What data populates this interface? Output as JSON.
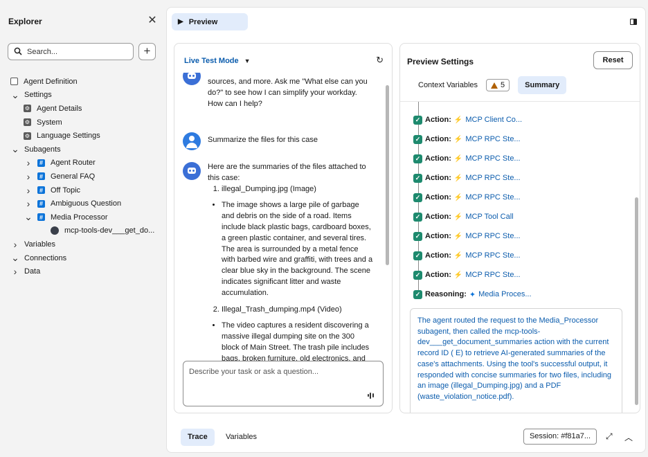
{
  "explorer": {
    "title": "Explorer",
    "search_placeholder": "Search...",
    "tree": [
      {
        "label": "Agent Definition",
        "icon": "document-icon",
        "indent": 0,
        "chevron": ""
      },
      {
        "label": "Settings",
        "icon": "",
        "indent": 0,
        "chevron": "down"
      },
      {
        "label": "Agent Details",
        "icon": "gear-icon",
        "indent": 1,
        "chevron": ""
      },
      {
        "label": "System",
        "icon": "gear-icon",
        "indent": 1,
        "chevron": ""
      },
      {
        "label": "Language Settings",
        "icon": "gear-icon",
        "indent": 1,
        "chevron": ""
      },
      {
        "label": "Subagents",
        "icon": "",
        "indent": 0,
        "chevron": "down"
      },
      {
        "label": "Agent Router",
        "icon": "hash-icon",
        "indent": 1,
        "chevron": "right"
      },
      {
        "label": "General FAQ",
        "icon": "hash-icon",
        "indent": 1,
        "chevron": "right"
      },
      {
        "label": "Off Topic",
        "icon": "hash-icon",
        "indent": 1,
        "chevron": "right"
      },
      {
        "label": "Ambiguous Question",
        "icon": "hash-icon",
        "indent": 1,
        "chevron": "right"
      },
      {
        "label": "Media Processor",
        "icon": "hash-icon",
        "indent": 1,
        "chevron": "down"
      },
      {
        "label": "mcp-tools-dev___get_do...",
        "icon": "tool-icon",
        "indent": 2,
        "chevron": ""
      },
      {
        "label": "Variables",
        "icon": "",
        "indent": 0,
        "chevron": "right"
      },
      {
        "label": "Connections",
        "icon": "",
        "indent": 0,
        "chevron": "down"
      },
      {
        "label": "Data",
        "icon": "",
        "indent": 0,
        "chevron": "right"
      }
    ]
  },
  "header": {
    "preview_tab": "Preview"
  },
  "chat": {
    "mode": "Live Test Mode",
    "msg1": "sources, and more. Ask me \"What else can you do?\" to see how I can simplify your workday. How can I help?",
    "msg2": "Summarize the files for this case",
    "msg3_intro": "Here are the summaries of the files attached to this case:",
    "file1": "illegal_Dumping.jpg (Image)",
    "file1_desc": "The image shows a large pile of garbage and debris on the side of a road. Items include black plastic bags, cardboard boxes, a green plastic container, and several tires. The area is surrounded by a metal fence with barbed wire and graffiti, with trees and a clear blue sky in the background. The scene indicates significant litter and waste accumulation.",
    "file2": "Illegal_Trash_dumping.mp4 (Video)",
    "file2_desc": "The video captures a resident discovering a massive illegal dumping site on the 300 block of Main Street. The trash pile includes bags, broken furniture, old electronics, and",
    "composer_placeholder": "Describe your task or ask a question..."
  },
  "settings": {
    "title": "Preview Settings",
    "reset": "Reset",
    "tab_context": "Context Variables",
    "warning_count": "5",
    "tab_summary": "Summary",
    "trace": [
      {
        "kind": "Action:",
        "name": "MCP Client Co...",
        "icon": "bolt-icon"
      },
      {
        "kind": "Action:",
        "name": "MCP RPC Ste...",
        "icon": "bolt-icon"
      },
      {
        "kind": "Action:",
        "name": "MCP RPC Ste...",
        "icon": "bolt-icon"
      },
      {
        "kind": "Action:",
        "name": "MCP RPC Ste...",
        "icon": "bolt-icon"
      },
      {
        "kind": "Action:",
        "name": "MCP RPC Ste...",
        "icon": "bolt-icon"
      },
      {
        "kind": "Action:",
        "name": "MCP Tool Call",
        "icon": "bolt-icon"
      },
      {
        "kind": "Action:",
        "name": "MCP RPC Ste...",
        "icon": "bolt-icon"
      },
      {
        "kind": "Action:",
        "name": "MCP RPC Ste...",
        "icon": "bolt-icon"
      },
      {
        "kind": "Action:",
        "name": "MCP RPC Ste...",
        "icon": "bolt-icon"
      },
      {
        "kind": "Reasoning:",
        "name": "Media Proces...",
        "icon": "sparkle-icon"
      }
    ],
    "summary_text": "The agent routed the request to the Media_Processor subagent, then called the mcp-tools-dev___get_document_summaries action with the current record ID (                        E) to retrieve AI-generated summaries of the case's attachments. Using the tool's successful output, it responded with concise summaries for two files, including an image (illegal_Dumping.jpg) and a PDF (waste_violation_notice.pdf)."
  },
  "footer": {
    "tab_trace": "Trace",
    "tab_variables": "Variables",
    "session": "Session: #f81a7..."
  },
  "colors": {
    "accent": "#0b5cad",
    "check": "#1e8a6e",
    "bolt": "#e39b20",
    "tab_active": "#e2ecfb"
  }
}
